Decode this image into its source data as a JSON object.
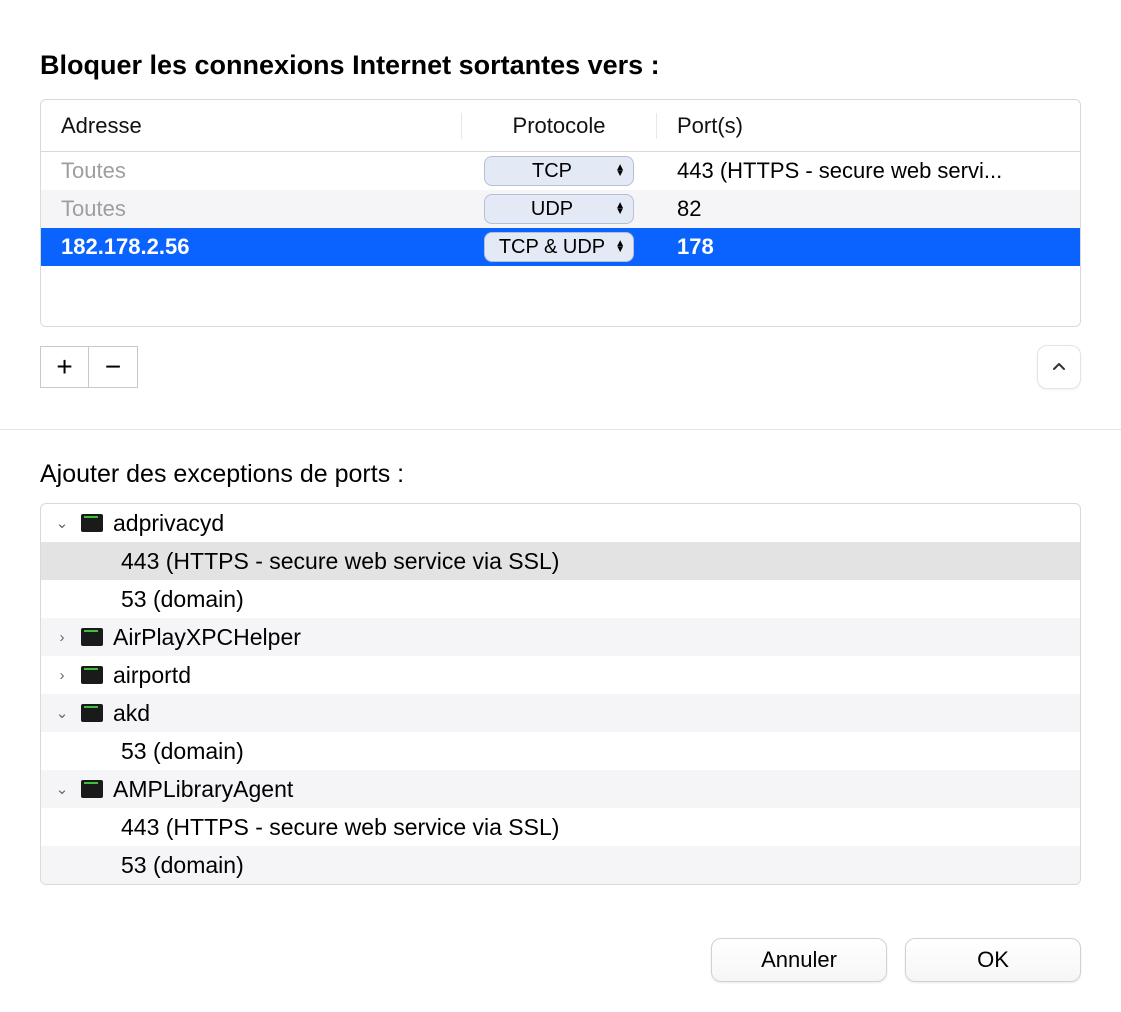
{
  "heading": "Bloquer les connexions Internet sortantes vers :",
  "table": {
    "headers": {
      "address": "Adresse",
      "protocol": "Protocole",
      "ports": "Port(s)"
    },
    "rows": [
      {
        "address": "Toutes",
        "protocol": "TCP",
        "ports": "443 (HTTPS - secure web servi...",
        "selected": false
      },
      {
        "address": "Toutes",
        "protocol": "UDP",
        "ports": "82",
        "selected": false
      },
      {
        "address": "182.178.2.56",
        "protocol": "TCP & UDP",
        "ports": "178",
        "selected": true
      }
    ]
  },
  "add_remove": {
    "add": "+",
    "remove": "−"
  },
  "exceptions_heading": "Ajouter des exceptions de ports :",
  "tree": [
    {
      "type": "app",
      "expanded": true,
      "label": "adprivacyd"
    },
    {
      "type": "child",
      "label": "443 (HTTPS - secure web service via SSL)",
      "highlighted": true
    },
    {
      "type": "child",
      "label": "53 (domain)"
    },
    {
      "type": "app",
      "expanded": false,
      "label": "AirPlayXPCHelper"
    },
    {
      "type": "app",
      "expanded": false,
      "label": "airportd"
    },
    {
      "type": "app",
      "expanded": true,
      "label": "akd"
    },
    {
      "type": "child",
      "label": "53 (domain)"
    },
    {
      "type": "app",
      "expanded": true,
      "label": "AMPLibraryAgent"
    },
    {
      "type": "child",
      "label": "443 (HTTPS - secure web service via SSL)"
    },
    {
      "type": "child",
      "label": "53 (domain)"
    }
  ],
  "buttons": {
    "cancel": "Annuler",
    "ok": "OK"
  }
}
